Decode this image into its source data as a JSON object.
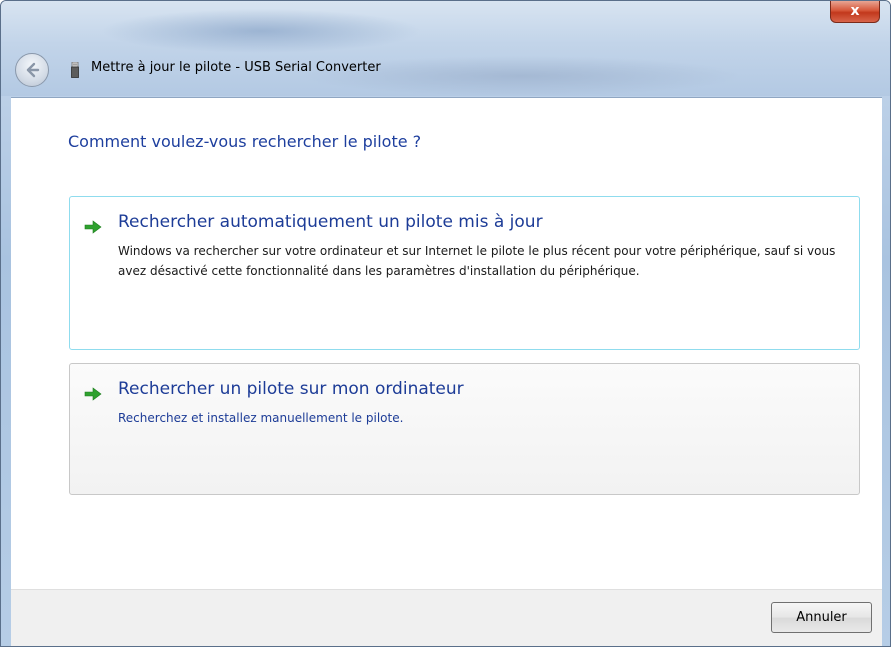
{
  "window": {
    "title": "Mettre à jour le pilote - USB Serial Converter",
    "close_label": "x"
  },
  "content": {
    "heading": "Comment voulez-vous rechercher le pilote ?",
    "options": [
      {
        "title": "Rechercher automatiquement un pilote mis à jour",
        "description": "Windows va rechercher sur votre ordinateur et sur Internet le pilote le plus récent pour votre périphérique, sauf si vous avez désactivé cette fonctionnalité dans les paramètres d'installation du périphérique."
      },
      {
        "title": "Rechercher un pilote sur mon ordinateur",
        "description": "Recherchez et installez manuellement le pilote."
      }
    ]
  },
  "footer": {
    "cancel_label": "Annuler"
  },
  "icons": {
    "back": "back-arrow-icon",
    "title": "usb-device-icon",
    "option": "green-arrow-icon"
  },
  "colors": {
    "heading": "#1e3f9e",
    "option_title": "#1d3c97",
    "arrow": "#2fa12f",
    "close": "#c7432a"
  }
}
